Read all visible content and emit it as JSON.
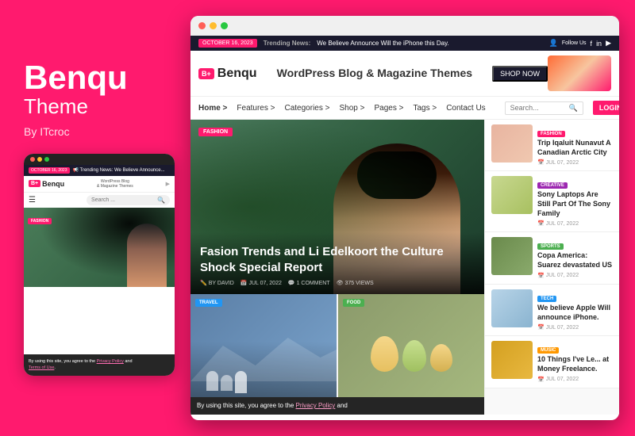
{
  "left": {
    "brand": "Benqu",
    "theme": "Theme",
    "by": "By ITcroc"
  },
  "mobile": {
    "news_badge": "OCTOBER 16, 2023",
    "search_placeholder": "Search ...",
    "cookie_text1": "By using this site, you agree to the ",
    "cookie_link1": "Privacy Policy",
    "cookie_text2": " and ",
    "cookie_link2": "Terms of Use",
    "cookie_period": "."
  },
  "browser": {
    "news_badge": "OCTOBER 16, 2023",
    "news_label": "Trending News:",
    "news_text": "We Believe Announce Will the iPhone this Day.",
    "logo_badge": "B+",
    "logo_name": "Benqu",
    "tagline": "WordPress Blog & Magazine Themes",
    "shop_now": "SHOP NOW",
    "nav": {
      "home": "Home >",
      "features": "Features >",
      "categories": "Categories >",
      "shop": "Shop >",
      "pages": "Pages >",
      "tags": "Tags >",
      "contact": "Contact Us"
    },
    "search_placeholder": "Search...",
    "login": "LOGIN",
    "hero": {
      "badge": "FASHION",
      "title": "Fasion Trends and Li Edelkoort the Culture Shock Special Report",
      "by": "BY DAVID",
      "date": "JUL 07, 2022",
      "comments": "1 COMMENT",
      "views": "375 VIEWS"
    },
    "small_articles": [
      {
        "badge": "TRAVEL",
        "badge_class": "badge-travel"
      },
      {
        "badge": "FOOD",
        "badge_class": "badge-food"
      }
    ],
    "sidebar": [
      {
        "cat": "FASHION",
        "cat_class": "cat-fashion",
        "thumb_class": "thumb-fashion",
        "title": "Trip Iqaluit Nunavut A Canadian Arctic City",
        "date": "JUL 07, 2022"
      },
      {
        "cat": "CREATIVE",
        "cat_class": "cat-creative",
        "thumb_class": "thumb-creative",
        "title": "Sony Laptops Are Still Part Of The Sony Family",
        "date": "JUL 07, 2022"
      },
      {
        "cat": "SPORTS",
        "cat_class": "cat-sports",
        "thumb_class": "thumb-sports",
        "title": "Copa America: Suarez devastated US",
        "date": "JUL 07, 2022"
      },
      {
        "cat": "TECH",
        "cat_class": "cat-tech",
        "thumb_class": "thumb-tech",
        "title": "We believe Apple Will announce iPhone.",
        "date": "JUL 07, 2022"
      },
      {
        "cat": "MUSIC",
        "cat_class": "cat-music",
        "thumb_class": "thumb-music",
        "title": "10 Things I've Le... at Money Freelance.",
        "date": "JUL 07, 2022"
      }
    ],
    "cookie_text": "By using this site, you agree to the ",
    "cookie_link": "Privacy Policy",
    "cookie_text2": " and"
  },
  "colors": {
    "pink": "#ff1a6e",
    "dark": "#1a1a2e",
    "green": "#4a7c59"
  }
}
